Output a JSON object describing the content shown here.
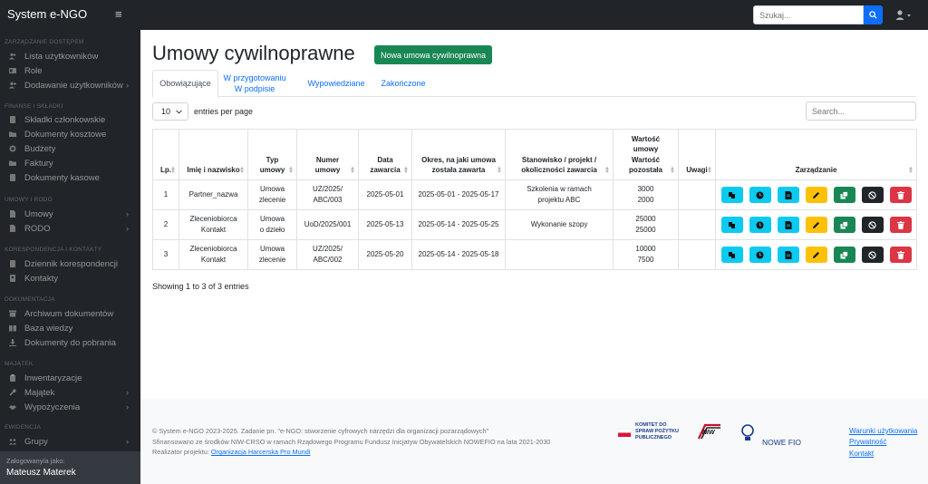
{
  "app": {
    "brand": "System e-NGO"
  },
  "topbar": {
    "search_placeholder": "Szukaj..."
  },
  "sidebar": {
    "sections": [
      {
        "heading": "ZARZĄDZANIE DOSTĘPEM",
        "items": [
          {
            "label": "Lista użytkowników",
            "icon": "users-icon"
          },
          {
            "label": "Role",
            "icon": "id-card-icon"
          },
          {
            "label": "Dodawanie użytkowników",
            "icon": "user-plus-icon",
            "arrow": "›"
          }
        ]
      },
      {
        "heading": "FINANSE I SKŁADKI",
        "items": [
          {
            "label": "Składki członkowskie",
            "icon": "document-icon"
          },
          {
            "label": "Dokumenty kosztowe",
            "icon": "folder-icon"
          },
          {
            "label": "Budżety",
            "icon": "coins-icon"
          },
          {
            "label": "Faktury",
            "icon": "folder-icon"
          },
          {
            "label": "Dokumenty kasowe",
            "icon": "document-icon"
          }
        ]
      },
      {
        "heading": "UMOWY I RODO",
        "items": [
          {
            "label": "Umowy",
            "icon": "file-icon",
            "arrow": "›"
          },
          {
            "label": "RODO",
            "icon": "file-icon",
            "arrow": "›"
          }
        ]
      },
      {
        "heading": "KORESPONDENCJA I KONTAKTY",
        "items": [
          {
            "label": "Dziennik korespondencji",
            "icon": "document-icon"
          },
          {
            "label": "Kontakty",
            "icon": "contact-icon"
          }
        ]
      },
      {
        "heading": "DOKUMENTACJA",
        "items": [
          {
            "label": "Archiwum dokumentów",
            "icon": "archive-icon"
          },
          {
            "label": "Baza wiedzy",
            "icon": "book-icon"
          },
          {
            "label": "Dokumenty do pobrania",
            "icon": "download-icon"
          }
        ]
      },
      {
        "heading": "MAJĄTEK",
        "items": [
          {
            "label": "Inwentaryzacje",
            "icon": "clipboard-icon"
          },
          {
            "label": "Majątek",
            "icon": "wrench-icon",
            "arrow": "›"
          },
          {
            "label": "Wypożyczenia",
            "icon": "handshake-icon",
            "arrow": "›"
          }
        ]
      },
      {
        "heading": "EWIDENCJA",
        "items": [
          {
            "label": "Grupy",
            "icon": "group-icon",
            "arrow": "›"
          }
        ]
      }
    ],
    "footer_label": "Zalogowany/a jako:",
    "footer_user": "Mateusz Materek"
  },
  "main": {
    "title": "Umowy cywilnoprawne",
    "new_button": "Nowa umowa cywilnoprawna",
    "tabs": [
      {
        "label": "Obowiązujące",
        "active": true
      },
      {
        "label": "W przygotowaniu",
        "label2": "W podpisie"
      },
      {
        "label": "Wypowiedziane"
      },
      {
        "label": "Zakończone"
      }
    ],
    "entries_value": "10",
    "entries_label": "entries per page",
    "search_placeholder": "Search...",
    "columns": [
      "Lp.",
      "Imię i nazwisko",
      "Typ umowy",
      "Numer umowy",
      "Data zawarcia",
      "Okres, na jaki umowa została zawarta",
      "Stanowisko / projekt / okoliczności zawarcia",
      "Wartość umowy Wartość pozostała",
      "Uwagi",
      "Zarządzanie"
    ],
    "rows": [
      {
        "lp": "1",
        "name": "Partner_nazwa",
        "type": "Umowa zlecenie",
        "number": "UZ/2025/ ABC/003",
        "date": "2025-05-01",
        "period": "2025-05-01 - 2025-05-17",
        "position": "Szkolenia w ramach projektu ABC",
        "value": "3000",
        "remaining": "2000",
        "notes": ""
      },
      {
        "lp": "2",
        "name": "Zleceniobiorca Kontakt",
        "type": "Umowa o dzieło",
        "number": "UoD/2025/001",
        "date": "2025-05-13",
        "period": "2025-05-14 - 2025-05-25",
        "position": "Wykonanie szopy",
        "value": "25000",
        "remaining": "25000",
        "notes": ""
      },
      {
        "lp": "3",
        "name": "Zleceniobiorca Kontakt",
        "type": "Umowa zlecenie",
        "number": "UZ/2025/ ABC/002",
        "date": "2025-05-20",
        "period": "2025-05-14 - 2025-05-18",
        "position": "",
        "value": "10000",
        "remaining": "7500",
        "notes": ""
      }
    ],
    "showing": "Showing 1 to 3 of 3 entries"
  },
  "footer": {
    "line1": "© System e-NGO 2023-2025. Zadanie pn. \"e-NGO: stworzenie cyfrowych narzędzi dla organizacji pozarządowych\"",
    "line2": "Sfinansowano ze środków NIW-CRSO w ramach Rządowego Programu Fundusz Inicjatyw Obywatelskich NOWEFIO na lata 2021-2030",
    "line3_prefix": "Realizator projektu: ",
    "line3_link": "Organizacja Harcerska Pro Mundi",
    "logo1": "KOMITET DO SPRAW POŻYTKU PUBLICZNEGO",
    "logo2": "NIW",
    "logo3": "NOWE FIO",
    "links": [
      "Warunki użytkowania",
      "Prywatność",
      "Kontakt"
    ]
  }
}
